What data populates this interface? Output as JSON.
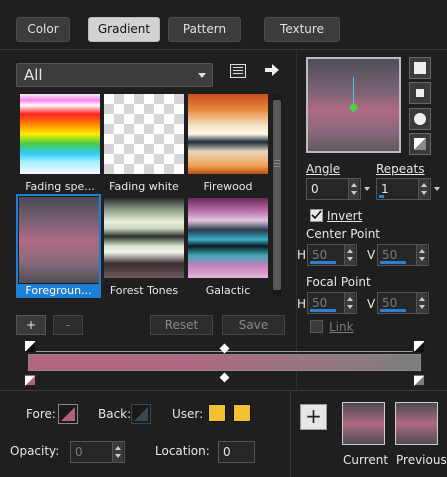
{
  "tabs": [
    {
      "label": "Color"
    },
    {
      "label": "Gradient",
      "active": true
    },
    {
      "label": "Pattern"
    },
    {
      "label": "Texture"
    }
  ],
  "category": {
    "selected": "All"
  },
  "icons": {
    "library": "library-icon",
    "export": "arrow-right-icon"
  },
  "swatches": [
    {
      "label": "Fading spe..."
    },
    {
      "label": "Fading white"
    },
    {
      "label": "Firewood"
    },
    {
      "label": "Foregroun...",
      "selected": true
    },
    {
      "label": "Forest Tones"
    },
    {
      "label": "Galactic"
    }
  ],
  "buttons": {
    "add": "+",
    "remove": "-",
    "reset": "Reset",
    "save": "Save"
  },
  "angle": {
    "label": "Angle",
    "value": "0"
  },
  "repeats": {
    "label": "Repeats",
    "value": "1"
  },
  "invert": {
    "label": "Invert",
    "checked": true
  },
  "center_point": {
    "label": "Center Point",
    "h_label": "H",
    "v_label": "V",
    "h": "50",
    "v": "50"
  },
  "focal_point": {
    "label": "Focal Point",
    "h_label": "H",
    "v_label": "V",
    "h": "50",
    "v": "50"
  },
  "link": {
    "label": "Link",
    "checked": false
  },
  "bottom": {
    "fore_label": "Fore:",
    "back_label": "Back:",
    "user_label": "User:",
    "opacity_label": "Opacity:",
    "opacity_value": "0",
    "location_label": "Location:",
    "location_value": "0",
    "current_label": "Current",
    "previous_label": "Previous",
    "plus": "+"
  },
  "colors": {
    "fore": "#b3607c",
    "user1": "#f2c12e",
    "user2": "#f2c12e",
    "accent": "#1e7fd6"
  }
}
